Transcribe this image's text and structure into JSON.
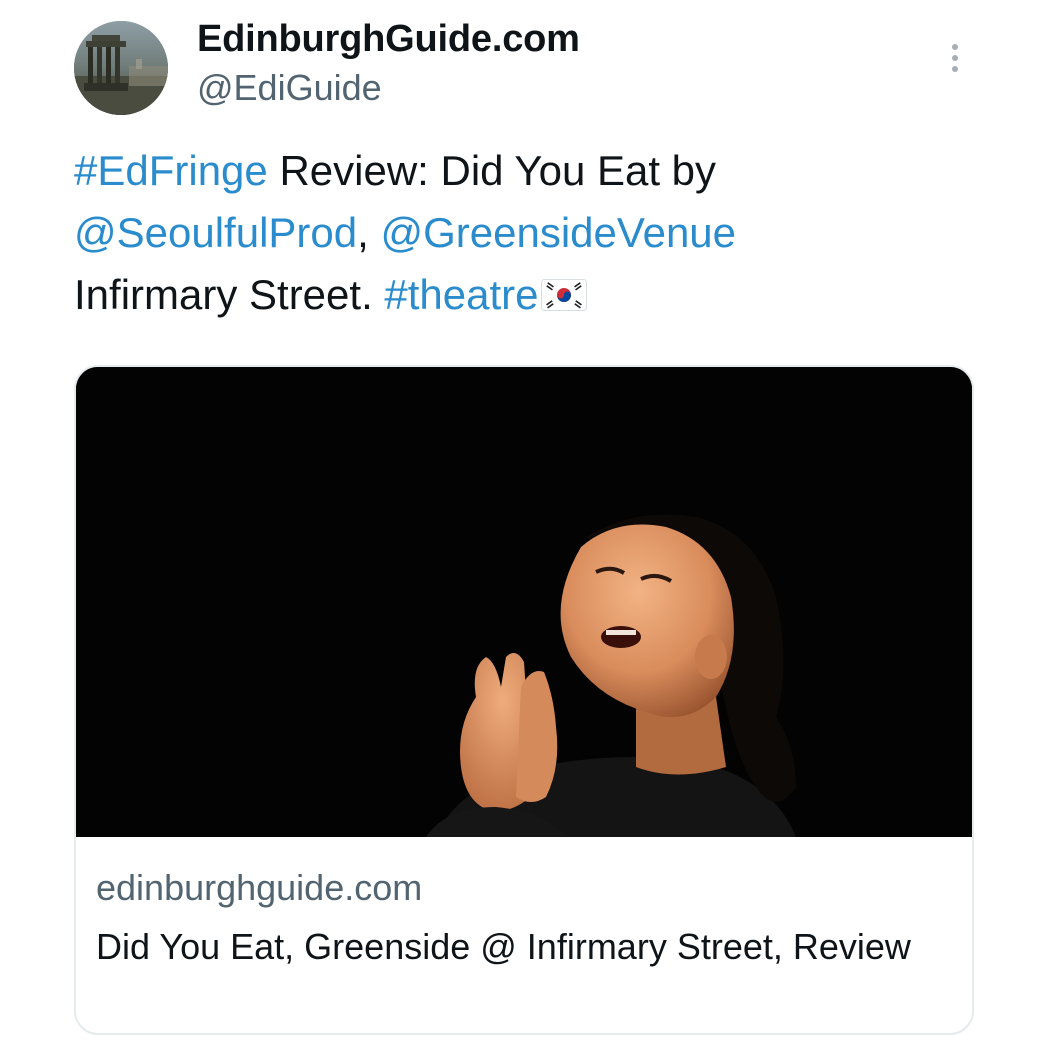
{
  "author": {
    "display_name": "EdinburghGuide.com",
    "handle": "@EdiGuide",
    "avatar_icon": "monument-avatar-icon"
  },
  "menu": {
    "icon": "more-vertical-icon"
  },
  "tweet": {
    "line1": {
      "hashtag": "#EdFringe",
      "text": " Review: Did You Eat by"
    },
    "line2": {
      "mention1": "@SeoulfulProd",
      "sep": ", ",
      "mention2": "@GreensideVenue"
    },
    "line3": {
      "text": "Infirmary Street. ",
      "hashtag": "#theatre",
      "emoji": "south-korea-flag-icon"
    }
  },
  "link_card": {
    "image": "performer-praying-photo",
    "domain": "edinburghguide.com",
    "title": "Did You Eat, Greenside @ Infirmary Street, Review"
  },
  "colors": {
    "link": "#2a8ccc",
    "text": "#0f1419",
    "secondary": "#536471",
    "card_border": "#e6ebee"
  }
}
